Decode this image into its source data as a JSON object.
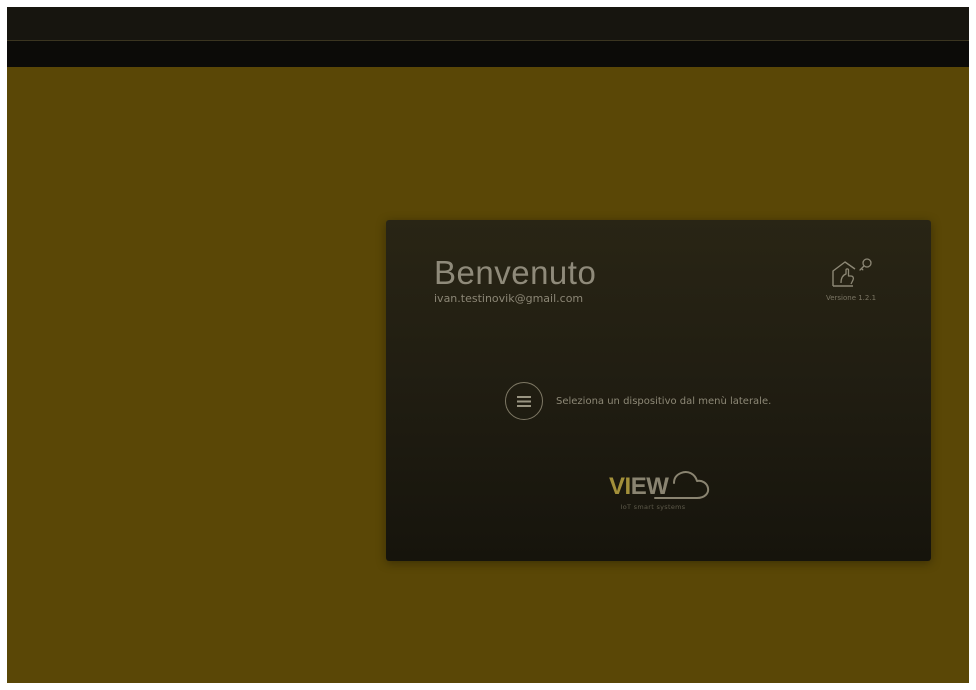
{
  "welcome": {
    "title": "Benvenuto",
    "email": "ivan.testinovik@gmail.com",
    "version": "Versione 1.2.1"
  },
  "hint": {
    "text": "Seleziona un dispositivo dal menù laterale."
  },
  "logo": {
    "brand_highlight": "VI",
    "brand_rest": "EW",
    "tagline": "IoT smart systems"
  },
  "icons": {
    "menu": "hamburger-menu-icon",
    "app": "smart-home-icon",
    "logo_cloud": "cloud-icon"
  },
  "colors": {
    "background": "#5a4706",
    "topbar": "#17150f",
    "card": "#241f12",
    "brand_accent": "#a3903a",
    "text": "#8f8a7a"
  }
}
